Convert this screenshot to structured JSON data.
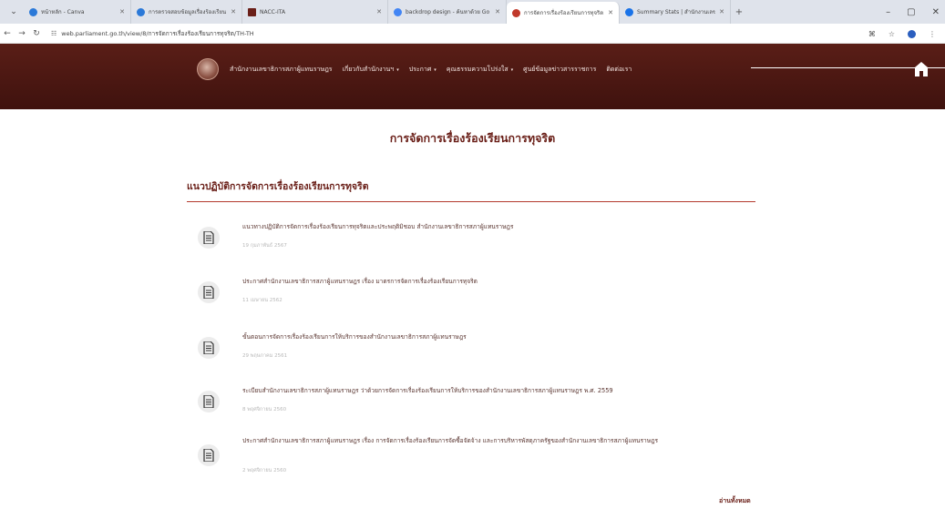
{
  "browser": {
    "tabs": [
      {
        "title": "หน้าหลัก - Canva",
        "favicon_color": "#2b79d8"
      },
      {
        "title": "การตรวจสอบข้อมูลเรื่องร้องเรียน",
        "favicon_color": "#2b79d8"
      },
      {
        "title": "NACC-ITA",
        "favicon_color": "#6a1f18"
      },
      {
        "title": "backdrop design - ค้นหาด้วย Go",
        "favicon_color": "#4285f4"
      },
      {
        "title": "การจัดการเรื่องร้องเรียนการทุจริต",
        "favicon_color": "#c0392b",
        "active": true
      },
      {
        "title": "Summary Stats | สำนักงานเลขาธิ",
        "favicon_color": "#1a73e8"
      }
    ],
    "new_tab": "+",
    "url": "web.parliament.go.th/view/8/การจัดการเรื่องร้องเรียนการทุจริต/TH-TH",
    "window_controls": {
      "minimize": "–",
      "maximize": "▢",
      "close": "✕"
    }
  },
  "site": {
    "nav": [
      {
        "label": "สำนักงานเลขาธิการสภาผู้แทนราษฎร",
        "has_caret": false
      },
      {
        "label": "เกี่ยวกับสำนักงานฯ",
        "has_caret": true
      },
      {
        "label": "ประกาศ",
        "has_caret": true
      },
      {
        "label": "คุณธรรมความโปร่งใส",
        "has_caret": true
      },
      {
        "label": "ศูนย์ข้อมูลข่าวสารราชการ",
        "has_caret": false
      },
      {
        "label": "ติดต่อเรา",
        "has_caret": false
      }
    ],
    "caret": "▾",
    "home_icon": "home-icon"
  },
  "main": {
    "page_title": "การจัดการเรื่องร้องเรียนการทุจริต",
    "section_title": "แนวปฏิบัติการจัดการเรื่องร้องเรียนการทุจริต",
    "documents": [
      {
        "title": "แนวทางปฏิบัติการจัดการเรื่องร้องเรียนการทุจริตและประพฤติมิชอบ สำนักงานเลขาธิการสภาผู้แทนราษฎร",
        "date": "19 กุมภาพันธ์ 2567"
      },
      {
        "title": "ประกาศสำนักงานเลขาธิการสภาผู้แทนราษฎร เรื่อง มาตรการจัดการเรื่องร้องเรียนการทุจริต",
        "date": "11 เมษายน 2562"
      },
      {
        "title": "ขั้นตอนการจัดการเรื่องร้องเรียนการให้บริการของสำนักงานเลขาธิการสภาผู้แทนราษฎร",
        "date": "29 พฤษภาคม 2561"
      },
      {
        "title": "ระเบียบสำนักงานเลขาธิการสภาผู้แทนราษฎร ว่าด้วยการจัดการเรื่องร้องเรียนการให้บริการของสำนักงานเลขาธิการสภาผู้แทนราษฎร พ.ศ. 2559",
        "date": "8 พฤศจิกายน 2560"
      },
      {
        "title": "ประกาศสำนักงานเลขาธิการสภาผู้แทนราษฎร เรื่อง การจัดการเรื่องร้องเรียนการจัดซื้อจัดจ้าง และการบริหารพัสดุภาครัฐของสำนักงานเลขาธิการสภาผู้แทนราษฎร",
        "date": "2 พฤศจิกายน 2560"
      }
    ],
    "read_all": "อ่านทั้งหมด"
  },
  "colors": {
    "header_bg": "#4a1611",
    "accent": "#6a1f18",
    "rule": "#b43a2e"
  }
}
